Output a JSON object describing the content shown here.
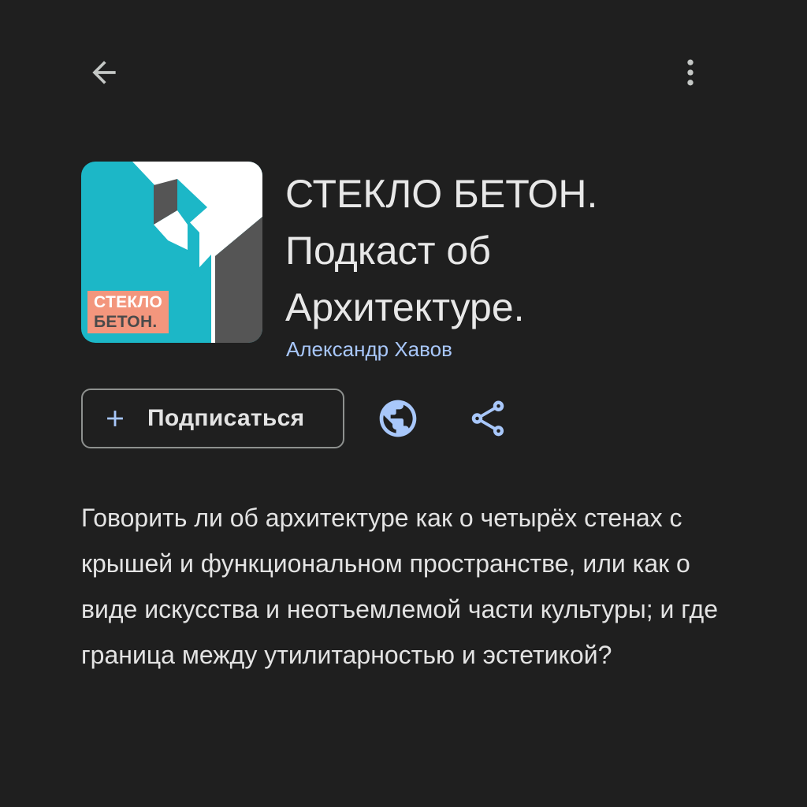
{
  "header": {
    "back_icon": "arrow-left-icon",
    "more_icon": "more-vert-icon"
  },
  "podcast": {
    "artwork_label_line1": "СТЕКЛО",
    "artwork_label_line2": "БЕТОН.",
    "title_lines": [
      "СТЕКЛО БЕТОН.",
      "Подкаст об",
      "Архитектуре."
    ],
    "author": "Александр Хавов"
  },
  "actions": {
    "subscribe_label": "Подписаться",
    "subscribe_icon": "plus-icon",
    "website_icon": "globe-icon",
    "share_icon": "share-icon"
  },
  "description": "Говорить ли об архитектуре как о четырёх стенах с крышей и функциональном пространстве, или как о виде искусства и неотъемлемой части культуры; и где граница между утилитарностью и эстетикой?",
  "colors": {
    "background": "#1f1f1f",
    "accent": "#a8c7fa",
    "artwork_teal": "#1cb7c7",
    "artwork_gray": "#555555",
    "artwork_salmon": "#f3967d"
  }
}
